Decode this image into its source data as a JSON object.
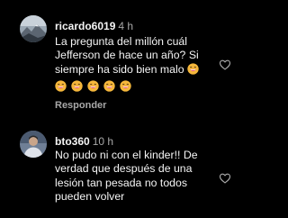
{
  "comments": [
    {
      "username": "ricardo6019",
      "time": "4 h",
      "text": "La pregunta del millón cuál Jefferson de hace un año? Si siempre ha sido bien malo",
      "reply_label": "Responder",
      "avatar": "avatar-mountain",
      "emojis": [
        "grinning-sweat-emoji",
        "grinning-sweat-emoji",
        "grinning-sweat-emoji",
        "grinning-sweat-emoji",
        "grinning-sweat-emoji"
      ],
      "like_icon": "heart-outline-icon"
    },
    {
      "username": "bto360",
      "time": "10 h",
      "text": "No pudo ni con el kinder!! De verdad que después de una lesión tan pesada no todos pueden volver",
      "avatar": "avatar-person",
      "like_icon": "heart-outline-icon"
    }
  ],
  "colors": {
    "background": "#000000",
    "text_primary": "#f5f5f5",
    "text_secondary": "#a8a8a8",
    "emoji_face": "#f5b73b",
    "emoji_mouth": "#e75a73"
  }
}
